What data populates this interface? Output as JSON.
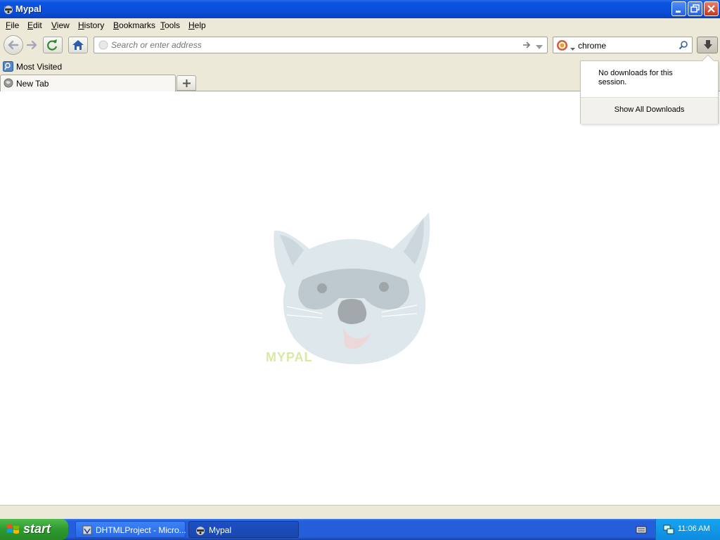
{
  "window": {
    "title": "Mypal"
  },
  "menubar": {
    "items": [
      {
        "accel": "F",
        "rest": "ile"
      },
      {
        "accel": "E",
        "rest": "dit"
      },
      {
        "accel": "V",
        "rest": "iew"
      },
      {
        "accel": "H",
        "rest": "istory"
      },
      {
        "accel": "B",
        "rest": "ookmarks"
      },
      {
        "accel": "T",
        "rest": "ools"
      },
      {
        "accel": "H",
        "rest": "elp"
      }
    ]
  },
  "navbar": {
    "url_placeholder": "Search or enter address",
    "url_value": "",
    "search_value": "chrome"
  },
  "bookmarks": {
    "items": [
      "Most Visited"
    ]
  },
  "tabs": {
    "items": [
      {
        "label": "New Tab"
      }
    ]
  },
  "downloads_panel": {
    "empty_message": "No downloads for this session.",
    "show_all_label": "Show All Downloads"
  },
  "newtab_page": {
    "logo_text": "MYPAL"
  },
  "taskbar": {
    "start_label": "start",
    "tasks": [
      {
        "label": "DHTMLProject - Micro..."
      },
      {
        "label": "Mypal"
      }
    ],
    "clock": "11:06 AM"
  },
  "colors": {
    "titlebar": "#0a54e3",
    "chrome_bg": "#ece9d8",
    "taskbar": "#245edb",
    "start": "#2e9a2e",
    "tray": "#0f8be0"
  }
}
